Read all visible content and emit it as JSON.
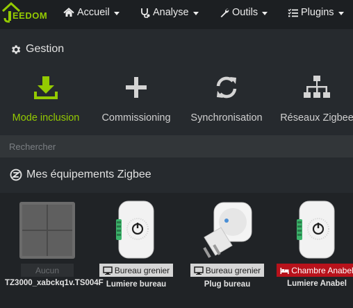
{
  "brand": {
    "logo_text": "EEDOM",
    "accent_color": "#94ca02"
  },
  "navbar": {
    "items": [
      {
        "label": "Accueil",
        "icon": "home-icon"
      },
      {
        "label": "Analyse",
        "icon": "stethoscope-icon"
      },
      {
        "label": "Outils",
        "icon": "wrench-icon"
      },
      {
        "label": "Plugins",
        "icon": "tasks-icon"
      }
    ]
  },
  "gestion": {
    "title": "Gestion",
    "items": [
      {
        "label": "Mode inclusion",
        "icon": "download-icon",
        "active": true
      },
      {
        "label": "Commissioning",
        "icon": "plus-icon"
      },
      {
        "label": "Synchronisation",
        "icon": "sync-icon"
      },
      {
        "label": "Réseaux Zigbee",
        "icon": "network-icon"
      }
    ]
  },
  "search": {
    "placeholder": "Rechercher",
    "value": ""
  },
  "devices_section": {
    "title": "Mes équipements Zigbee",
    "devices": [
      {
        "name": "TZ3000_xabckq1v.TS004F",
        "room": "Aucun",
        "room_style": "none",
        "image": "wall-switch-4-gang"
      },
      {
        "name": "Lumiere bureau",
        "room": "Bureau grenier",
        "room_style": "grey",
        "room_icon": "desktop-icon",
        "image": "relay-module"
      },
      {
        "name": "Plug bureau",
        "room": "Bureau grenier",
        "room_style": "grey",
        "room_icon": "desktop-icon",
        "image": "smart-plug"
      },
      {
        "name": "Lumiere Anabel",
        "room": "Chambre Anabel",
        "room_style": "red",
        "room_icon": "bed-icon",
        "image": "relay-module"
      }
    ]
  }
}
